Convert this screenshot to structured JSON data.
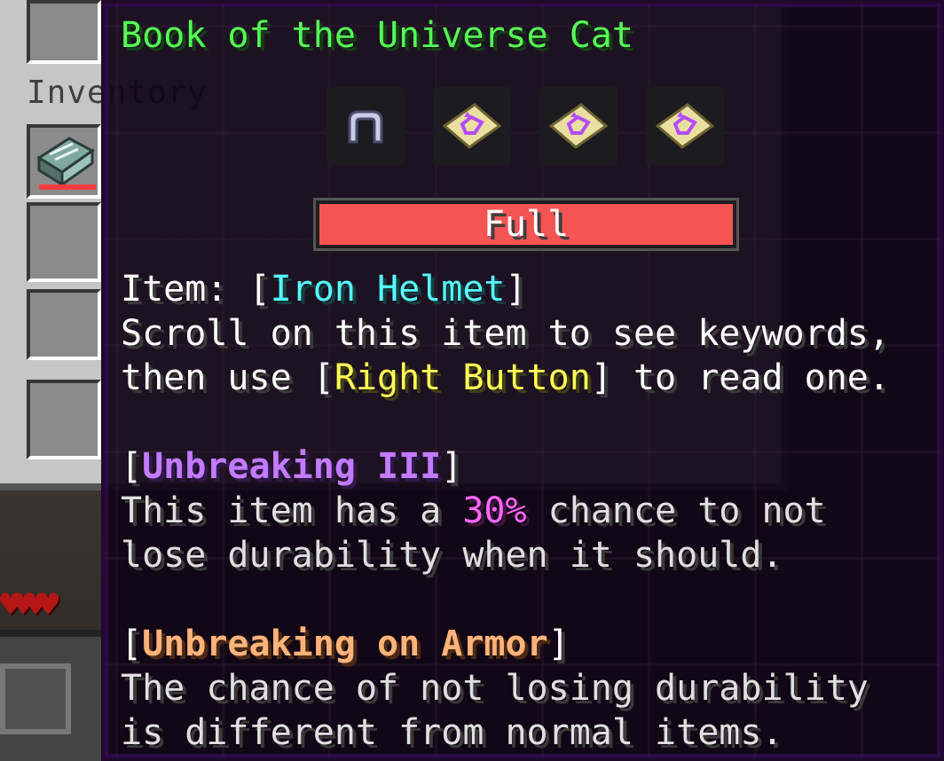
{
  "background": {
    "inventory_label": "Inventory"
  },
  "tooltip": {
    "title": "Book of the Universe Cat",
    "slots": [
      {
        "icon": "iron-helmet-icon"
      },
      {
        "icon": "universe-cat-paper-icon"
      },
      {
        "icon": "universe-cat-paper-icon"
      },
      {
        "icon": "universe-cat-paper-icon"
      }
    ],
    "status_bar": {
      "label": "Full",
      "color": "#f55454"
    },
    "item_line": {
      "prefix": "Item: [",
      "item_name": "Iron Helmet",
      "suffix": "]"
    },
    "instructions": {
      "line1": "Scroll on this item to see keywords,",
      "line2_prefix": "then use [",
      "line2_key": "Right Button",
      "line2_suffix": "] to read one."
    },
    "keyword1": {
      "open": "[",
      "name": "Unbreaking III",
      "close": "]",
      "desc1_prefix": "This item has a ",
      "desc1_value": "30%",
      "desc1_suffix": " chance to not",
      "desc2": "lose durability when it should."
    },
    "keyword2": {
      "open": "[",
      "name": "Unbreaking on Armor",
      "close": "]",
      "desc1": "The chance of not losing durability",
      "desc2": "is different from normal items."
    }
  },
  "colors": {
    "title": "#55ff55",
    "item_name": "#55ffff",
    "key_name": "#ffff55",
    "keyword1": "#c27bff",
    "keyword2": "#ffb37a",
    "percent": "#ff66ff"
  }
}
